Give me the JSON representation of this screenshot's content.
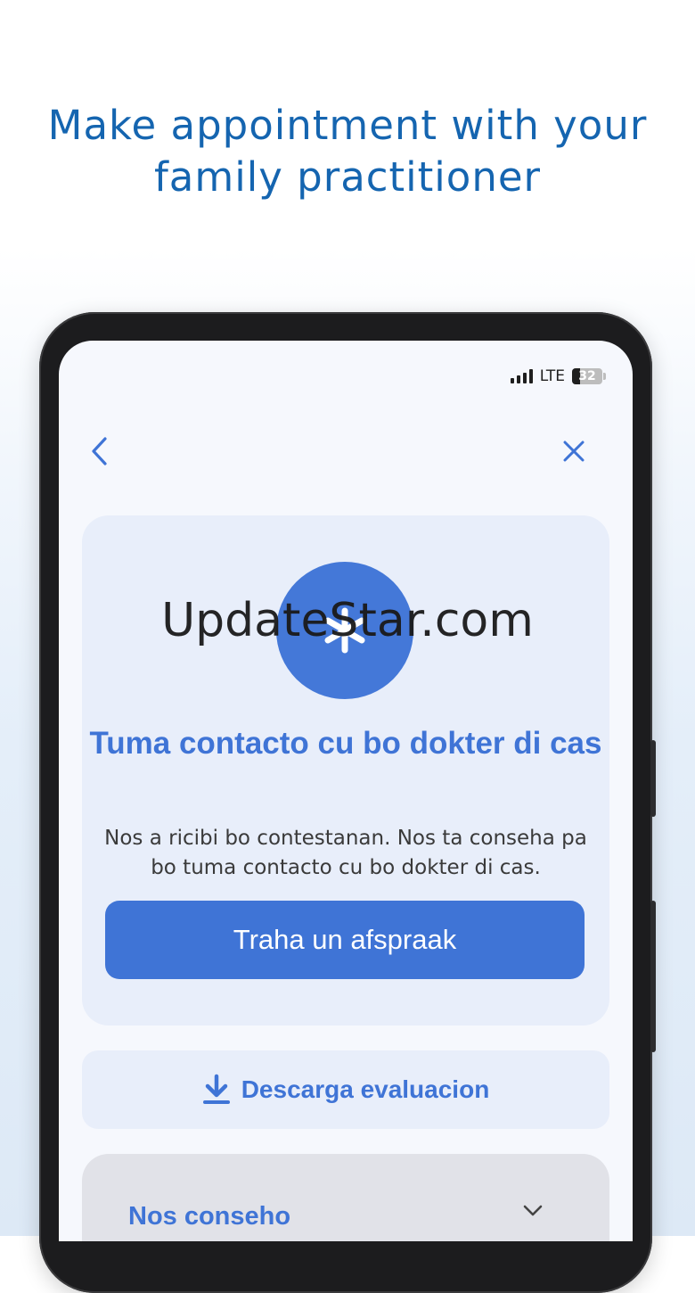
{
  "headline": "Make appointment with your\nfamily practitioner",
  "status_bar": {
    "network": "LTE",
    "battery": "32"
  },
  "nav": {
    "back_icon": "chevron-left-icon",
    "close_icon": "close-icon"
  },
  "card": {
    "icon": "asterisk-icon",
    "title": "Tuma contacto cu bo dokter di cas",
    "text": "Nos a ricibi bo contestanan. Nos ta conseha pa bo tuma contacto cu bo dokter di cas.",
    "button_label": "Traha un afspraak"
  },
  "download": {
    "icon": "download-icon",
    "label": "Descarga evaluacion"
  },
  "accordion": {
    "label": "Nos conseho",
    "icon": "chevron-down-icon"
  },
  "watermark": "UpdateStar.com",
  "colors": {
    "accent": "#3f74d6",
    "headline": "#1565b0",
    "card_bg": "#e8eefa"
  }
}
